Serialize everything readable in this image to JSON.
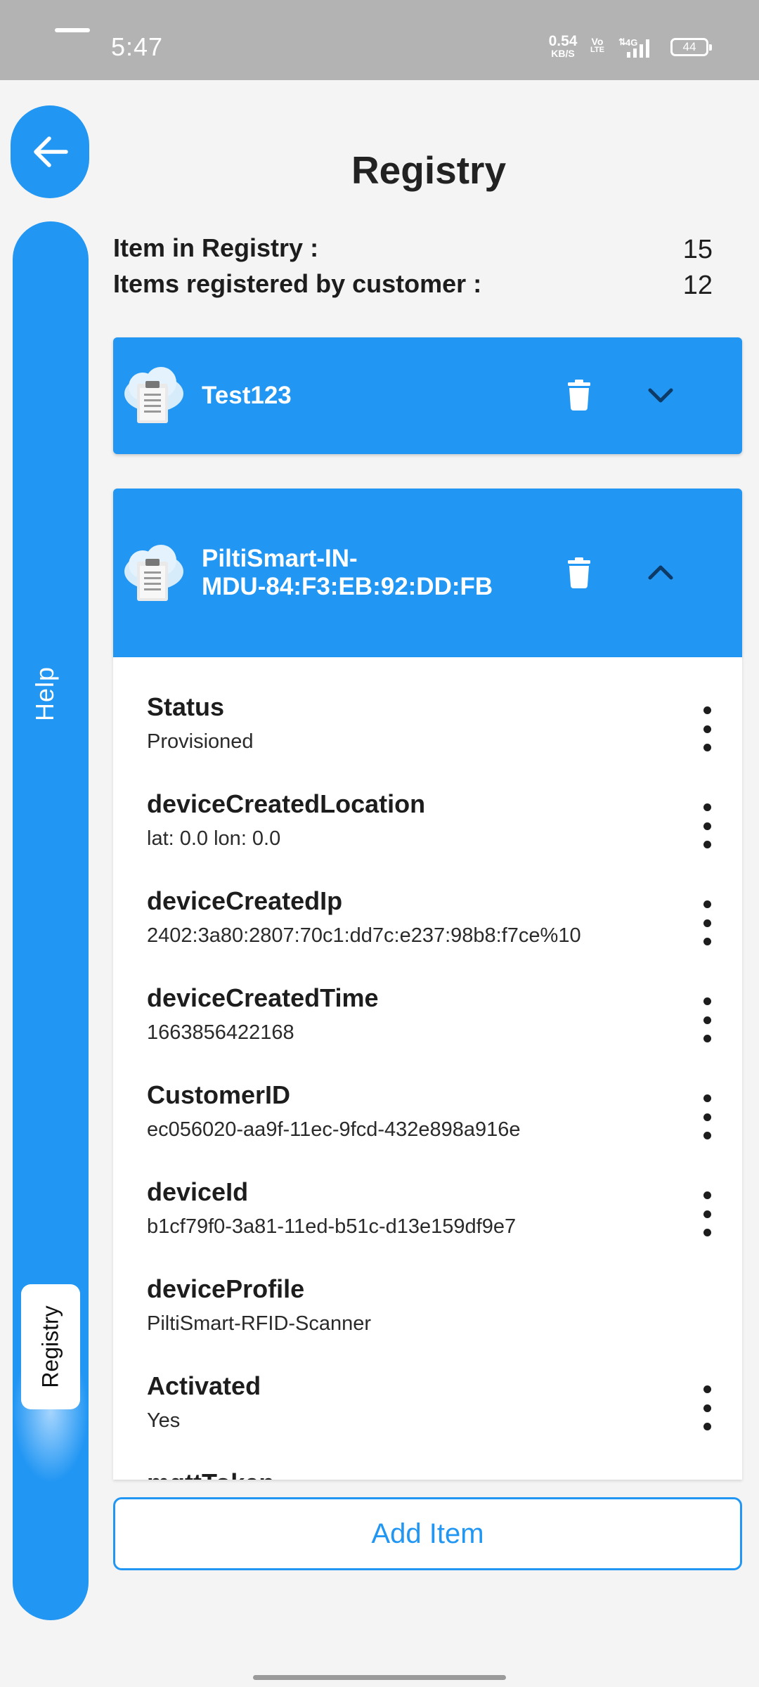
{
  "status_bar": {
    "time": "5:47",
    "net_speed_value": "0.54",
    "net_speed_unit": "KB/S",
    "volte_top": "Vo",
    "volte_bottom": "LTE",
    "network": "4G",
    "battery": "44"
  },
  "navigation": {
    "back_icon": "arrow-left-icon",
    "rail_items": [
      "Help",
      "Registry"
    ],
    "active_rail_item": "Registry"
  },
  "header": {
    "title": "Registry"
  },
  "stats": [
    {
      "label": "Item in Registry :",
      "value": "15"
    },
    {
      "label": "Items registered by customer :",
      "value": "12"
    }
  ],
  "cards": [
    {
      "title": "Test123",
      "expanded": false,
      "icon": "cloud-clipboard-icon"
    },
    {
      "title_line1": "PiltiSmart-IN-",
      "title_line2": "MDU-84:F3:EB:92:DD:FB",
      "expanded": true,
      "icon": "cloud-clipboard-icon"
    }
  ],
  "properties": [
    {
      "key": "Status",
      "value": "Provisioned",
      "has_menu": true
    },
    {
      "key": "deviceCreatedLocation",
      "value": "lat: 0.0 lon: 0.0",
      "has_menu": true
    },
    {
      "key": "deviceCreatedIp",
      "value": "2402:3a80:2807:70c1:dd7c:e237:98b8:f7ce%10",
      "has_menu": true
    },
    {
      "key": "deviceCreatedTime",
      "value": "1663856422168",
      "has_menu": true
    },
    {
      "key": "CustomerID",
      "value": "ec056020-aa9f-11ec-9fcd-432e898a916e",
      "has_menu": true
    },
    {
      "key": "deviceId",
      "value": "b1cf79f0-3a81-11ed-b51c-d13e159df9e7",
      "has_menu": true
    },
    {
      "key": "deviceProfile",
      "value": "PiltiSmart-RFID-Scanner",
      "has_menu": false
    },
    {
      "key": "Activated",
      "value": "Yes",
      "has_menu": true
    },
    {
      "key": "mqttToken",
      "value": "",
      "has_menu": false
    }
  ],
  "actions": {
    "add_item": "Add Item"
  },
  "colors": {
    "accent": "#2196f3",
    "background": "#f4f4f4",
    "status_bar": "#b3b3b3"
  }
}
